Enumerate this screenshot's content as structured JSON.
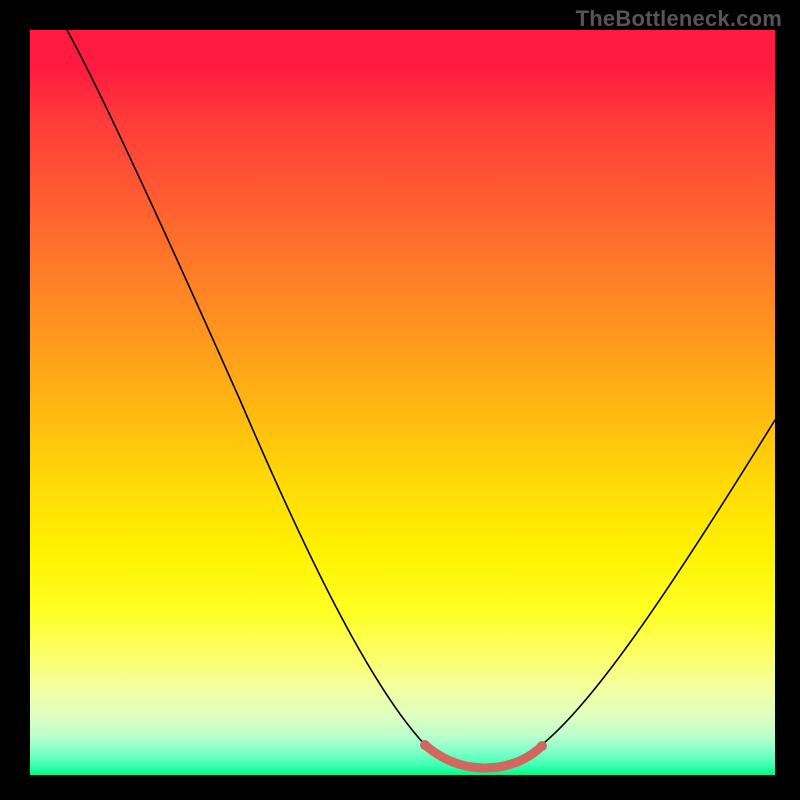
{
  "watermark": "TheBottleneck.com",
  "chart_data": {
    "type": "line",
    "title": "",
    "xlabel": "",
    "ylabel": "",
    "xlim": [
      0,
      100
    ],
    "ylim": [
      0,
      100
    ],
    "series": [
      {
        "name": "curve",
        "x": [
          5,
          10,
          15,
          20,
          25,
          30,
          35,
          40,
          45,
          50,
          54,
          58,
          62,
          66,
          70,
          75,
          80,
          85,
          90,
          95,
          100
        ],
        "values": [
          100,
          89,
          78,
          68,
          58,
          49,
          40,
          32,
          24,
          16,
          9,
          4,
          2,
          2,
          4,
          8,
          15,
          24,
          34,
          45,
          56
        ]
      }
    ],
    "trough_marker": {
      "x_start": 55,
      "x_end": 70,
      "y": 2
    },
    "colors": {
      "background_top": "#ff1a3f",
      "background_bottom": "#0af487",
      "curve": "#000000",
      "trough_marker": "#d1675e",
      "frame": "#000000"
    }
  }
}
